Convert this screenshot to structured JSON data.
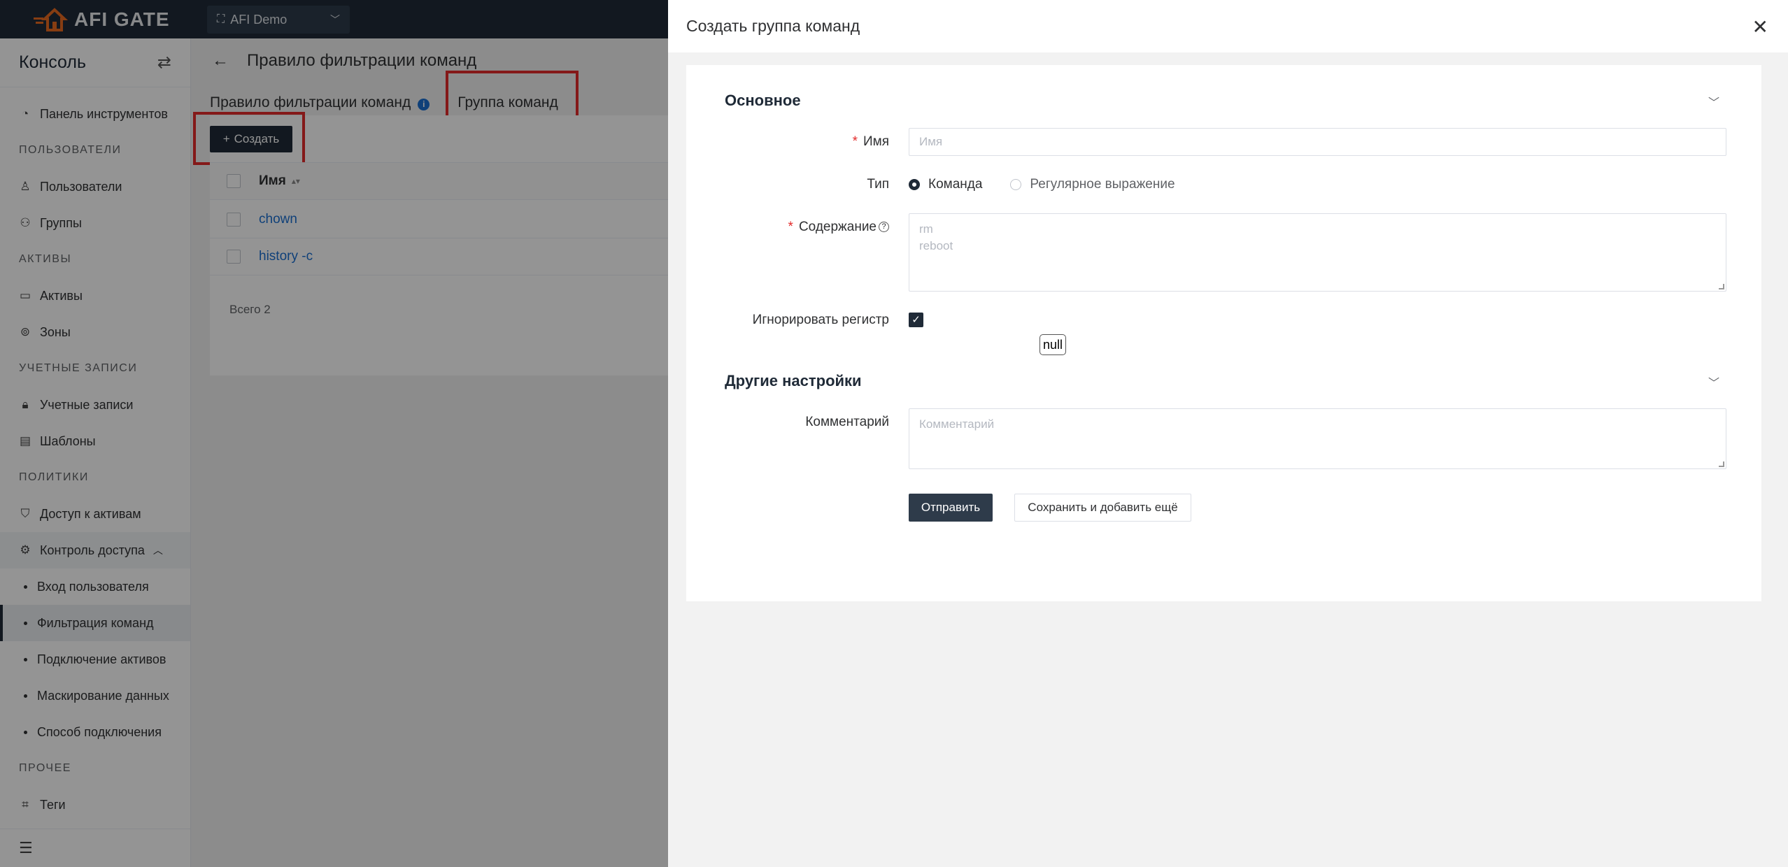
{
  "app": {
    "brand": "AFI GATE",
    "org_selector": "AFI Demo",
    "colors": {
      "topbar": "#1f2a37",
      "accent": "#1f2a37",
      "link": "#1a6fd1",
      "required": "#e32b2b",
      "highlight": "#e32b2b"
    }
  },
  "sidebar": {
    "title": "Консоль",
    "dashboard": "Панель инструментов",
    "groups": {
      "users": "ПОЛЬЗОВАТЕЛИ",
      "assets": "АКТИВЫ",
      "accounts": "УЧЕТНЫЕ ЗАПИСИ",
      "policies": "ПОЛИТИКИ",
      "other": "ПРОЧЕЕ"
    },
    "items": {
      "users": "Пользователи",
      "groups": "Группы",
      "assets": "Активы",
      "zones": "Зоны",
      "accounts": "Учетные записи",
      "templates": "Шаблоны",
      "asset_access": "Доступ к активам",
      "access_control": "Контроль доступа",
      "user_login": "Вход пользователя",
      "command_filter": "Фильтрация команд",
      "asset_connect": "Подключение активов",
      "data_masking": "Маскирование данных",
      "connect_method": "Способ подключения",
      "tags": "Теги"
    }
  },
  "main": {
    "page_title": "Правило фильтрации команд",
    "tabs": [
      "Правило фильтрации команд",
      "Группа команд"
    ],
    "create_button": "Создать",
    "table": {
      "column_name": "Имя",
      "rows": [
        "chown",
        "history -c"
      ],
      "total": "Всего 2"
    }
  },
  "drawer": {
    "title": "Создать группа команд",
    "section_basic": "Основное",
    "name_label": "Имя",
    "name_placeholder": "Имя",
    "type_label": "Тип",
    "type_options": [
      "Команда",
      "Регулярное выражение"
    ],
    "content_label": "Содержание",
    "content_placeholder_lines": [
      "rm",
      "reboot"
    ],
    "ignore_case_label": "Игнорировать регистр",
    "null_tag": "null",
    "section_other": "Другие настройки",
    "comment_label": "Комментарий",
    "comment_placeholder": "Комментарий",
    "submit_button": "Отправить",
    "save_add_button": "Сохранить и добавить ещё"
  }
}
